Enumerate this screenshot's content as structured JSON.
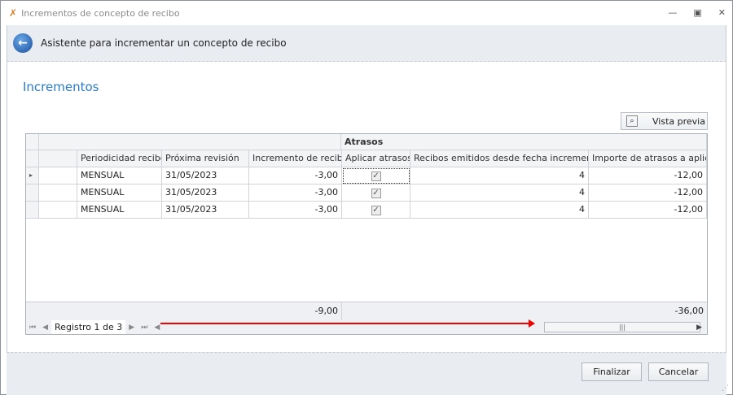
{
  "window": {
    "title": "Incrementos de concepto de recibo",
    "minimize": "—",
    "restore": "▣",
    "close": "✕"
  },
  "header": {
    "title": "Asistente para incrementar un concepto de recibo"
  },
  "section": {
    "title": "Incrementos"
  },
  "toolbar": {
    "preview_label": "Vista previa"
  },
  "grid": {
    "band": "Atrasos",
    "columns": [
      "Periodicidad recibo",
      "Próxima revisión",
      "Incremento de recibo",
      "Aplicar atrasos",
      "Recibos emitidos desde fecha incremento",
      "Importe de atrasos a aplicar"
    ],
    "rows": [
      {
        "periodicidad": "MENSUAL",
        "revision": "31/05/2023",
        "incremento": "-3,00",
        "aplicar": true,
        "recibos": "4",
        "importe": "-12,00"
      },
      {
        "periodicidad": "MENSUAL",
        "revision": "31/05/2023",
        "incremento": "-3,00",
        "aplicar": true,
        "recibos": "4",
        "importe": "-12,00"
      },
      {
        "periodicidad": "MENSUAL",
        "revision": "31/05/2023",
        "incremento": "-3,00",
        "aplicar": true,
        "recibos": "4",
        "importe": "-12,00"
      }
    ],
    "totals": {
      "incremento": "-9,00",
      "importe": "-36,00"
    },
    "navigator": {
      "record_label": "Registro 1 de 3"
    }
  },
  "footer": {
    "finish_label": "Finalizar",
    "cancel_label": "Cancelar"
  }
}
